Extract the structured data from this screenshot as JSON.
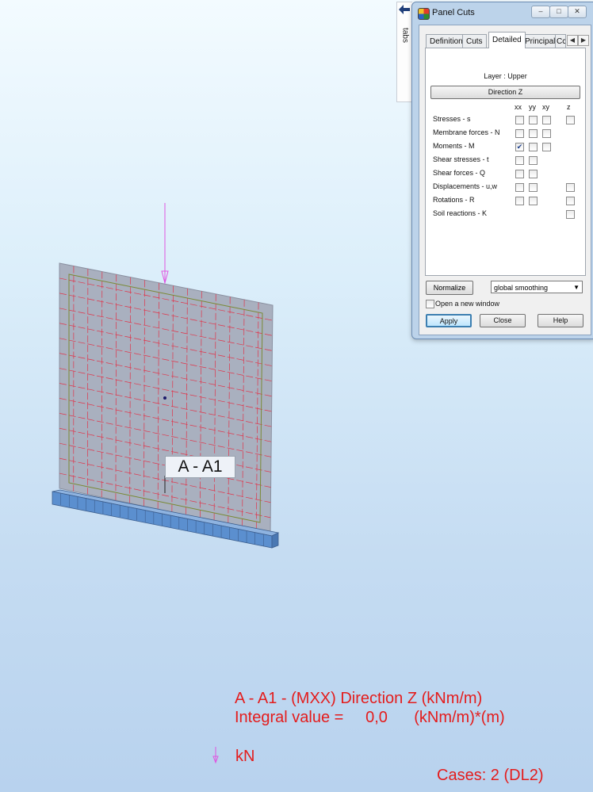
{
  "viewport": {
    "cut_label": "A - A1",
    "result_title": "A - A1 - (MXX) Direction Z (kNm/m)",
    "integral_text": "Integral value =     0,0      (kNm/m)*(m)",
    "load_unit": "kN",
    "cases": "Cases: 2 (DL2)",
    "colors": {
      "result_text": "#e41c1c",
      "load_arrow": "#e055e0",
      "mesh_red": "#e0344a",
      "mesh_green": "#7a8a35",
      "panel_fill": "#a9b0bf",
      "support": "#5b8fcf"
    }
  },
  "tabs_strip": {
    "label": "tabs",
    "icon": "arrow-left-icon"
  },
  "dialog": {
    "title": "Panel Cuts",
    "window_buttons": {
      "minimize": "–",
      "restore": "□",
      "close": "✕"
    },
    "tabs": [
      "Definition",
      "Cuts",
      "Detailed",
      "Principal",
      "Cc"
    ],
    "active_tab": "Detailed",
    "layer": "Layer : Upper",
    "direction_button": "Direction Z",
    "columns": [
      "xx",
      "yy",
      "xy",
      "z"
    ],
    "rows": [
      {
        "label": "Stresses - s",
        "xx": false,
        "yy": false,
        "xy": false,
        "z": false
      },
      {
        "label": "Membrane forces - N",
        "xx": false,
        "yy": false,
        "xy": false
      },
      {
        "label": "Moments - M",
        "xx": true,
        "yy": false,
        "xy": false
      },
      {
        "label": "Shear stresses - t",
        "xx": false,
        "yy": false
      },
      {
        "label": "Shear forces - Q",
        "xx": false,
        "yy": false
      },
      {
        "label": "Displacements - u,w",
        "xx": false,
        "yy": false,
        "z": false
      },
      {
        "label": "Rotations - R",
        "xx": false,
        "yy": false,
        "z": false
      },
      {
        "label": "Soil reactions - K",
        "z": false
      }
    ],
    "normalize_button": "Normalize",
    "smoothing": {
      "selected": "global smoothing"
    },
    "open_new_window": {
      "label": "Open a new window",
      "checked": false
    },
    "buttons": {
      "apply": "Apply",
      "close": "Close",
      "help": "Help"
    }
  }
}
